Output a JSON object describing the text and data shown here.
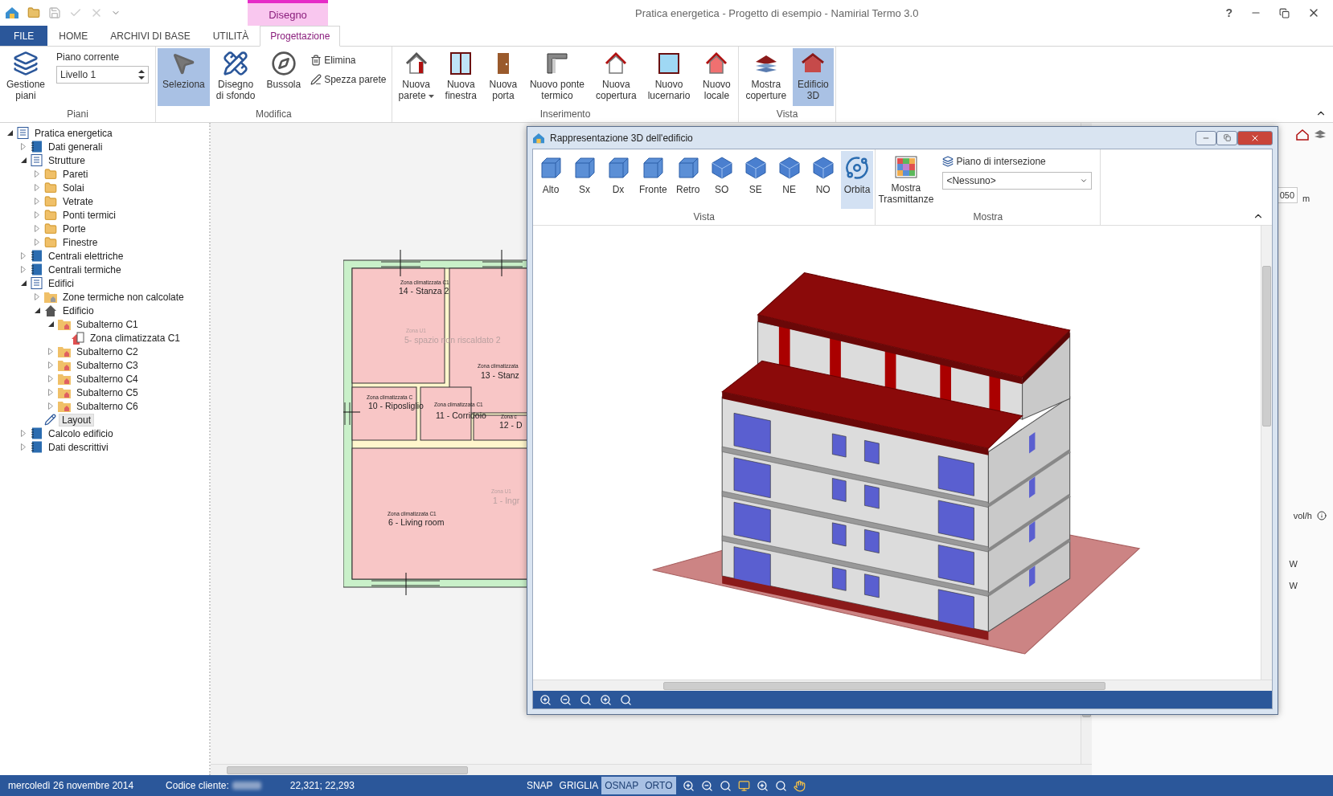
{
  "title_bar": {
    "contextual_tab": "Disegno",
    "title": "Pratica energetica - Progetto di esempio - Namirial Termo 3.0",
    "help": "?"
  },
  "tabs": [
    {
      "label": "FILE",
      "kind": "file",
      "selected": false
    },
    {
      "label": "HOME",
      "kind": "normal",
      "selected": false
    },
    {
      "label": "ARCHIVI DI BASE",
      "kind": "normal",
      "selected": false
    },
    {
      "label": "UTILITÀ",
      "kind": "normal",
      "selected": false
    },
    {
      "label": "Progettazione",
      "kind": "contextual",
      "selected": true
    }
  ],
  "ribbon": {
    "groups": [
      {
        "label": "Piani",
        "items": [
          {
            "kind": "large",
            "label": "Gestione\npiani",
            "selected": false,
            "dropdown": false
          },
          {
            "kind": "spinner",
            "label": "Piano corrente",
            "value": "Livello 1"
          }
        ]
      },
      {
        "label": "Modifica",
        "items": [
          {
            "kind": "large",
            "label": "Seleziona",
            "selected": true,
            "dropdown": false
          },
          {
            "kind": "large",
            "label": "Disegno\ndi sfondo",
            "selected": false,
            "dropdown": false
          },
          {
            "kind": "large",
            "label": "Bussola",
            "selected": false,
            "dropdown": false
          },
          {
            "kind": "stack",
            "items": [
              {
                "label": "Elimina"
              },
              {
                "label": "Spezza parete"
              }
            ]
          }
        ]
      },
      {
        "label": "Inserimento",
        "items": [
          {
            "kind": "large",
            "label": "Nuova\nparete",
            "selected": false,
            "dropdown": true
          },
          {
            "kind": "large",
            "label": "Nuova\nfinestra",
            "selected": false,
            "dropdown": false
          },
          {
            "kind": "large",
            "label": "Nuova\nporta",
            "selected": false,
            "dropdown": false
          },
          {
            "kind": "large",
            "label": "Nuovo ponte\ntermico",
            "selected": false,
            "dropdown": false
          },
          {
            "kind": "large",
            "label": "Nuova\ncopertura",
            "selected": false,
            "dropdown": false
          },
          {
            "kind": "large",
            "label": "Nuovo\nlucernario",
            "selected": false,
            "dropdown": false
          },
          {
            "kind": "large",
            "label": "Nuovo\nlocale",
            "selected": false,
            "dropdown": false
          }
        ]
      },
      {
        "label": "Vista",
        "items": [
          {
            "kind": "large",
            "label": "Mostra\ncoperture",
            "selected": false,
            "dropdown": false
          },
          {
            "kind": "large",
            "label": "Edificio\n3D",
            "selected": true,
            "dropdown": false
          }
        ]
      }
    ]
  },
  "tree": [
    {
      "label": "Pratica energetica",
      "kind": "section",
      "expanded": true,
      "selected": false,
      "children": [
        {
          "label": "Dati generali",
          "kind": "book",
          "expanded": false,
          "selected": false
        },
        {
          "label": "Strutture",
          "kind": "section",
          "expanded": true,
          "selected": false,
          "children": [
            {
              "label": "Pareti",
              "kind": "folder",
              "expanded": false,
              "selected": false
            },
            {
              "label": "Solai",
              "kind": "folder",
              "expanded": false,
              "selected": false
            },
            {
              "label": "Vetrate",
              "kind": "folder",
              "expanded": false,
              "selected": false
            },
            {
              "label": "Ponti termici",
              "kind": "folder",
              "expanded": false,
              "selected": false
            },
            {
              "label": "Porte",
              "kind": "folder",
              "expanded": false,
              "selected": false
            },
            {
              "label": "Finestre",
              "kind": "folder",
              "expanded": false,
              "selected": false
            }
          ]
        },
        {
          "label": "Centrali elettriche",
          "kind": "book",
          "expanded": false,
          "selected": false
        },
        {
          "label": "Centrali termiche",
          "kind": "book",
          "expanded": false,
          "selected": false
        },
        {
          "label": "Edifici",
          "kind": "section",
          "expanded": true,
          "selected": false,
          "children": [
            {
              "label": "Zone termiche non calcolate",
              "kind": "zonefolder",
              "expanded": false,
              "selected": false
            },
            {
              "label": "Edificio",
              "kind": "house",
              "expanded": true,
              "selected": false,
              "children": [
                {
                  "label": "Subalterno C1",
                  "kind": "subfolder",
                  "expanded": true,
                  "selected": false,
                  "children": [
                    {
                      "label": "Zona climatizzata C1",
                      "kind": "zone",
                      "selected": false
                    }
                  ]
                },
                {
                  "label": "Subalterno C2",
                  "kind": "subfolder",
                  "expanded": false,
                  "selected": false
                },
                {
                  "label": "Subalterno C3",
                  "kind": "subfolder",
                  "expanded": false,
                  "selected": false
                },
                {
                  "label": "Subalterno C4",
                  "kind": "subfolder",
                  "expanded": false,
                  "selected": false
                },
                {
                  "label": "Subalterno C5",
                  "kind": "subfolder",
                  "expanded": false,
                  "selected": false
                },
                {
                  "label": "Subalterno C6",
                  "kind": "subfolder",
                  "expanded": false,
                  "selected": false
                }
              ]
            },
            {
              "label": "Layout",
              "kind": "layout",
              "selected": true
            }
          ]
        },
        {
          "label": "Calcolo edificio",
          "kind": "book",
          "expanded": false,
          "selected": false
        },
        {
          "label": "Dati descrittivi",
          "kind": "book",
          "expanded": false,
          "selected": false
        }
      ]
    }
  ],
  "floor_plan": {
    "rooms": [
      {
        "zone": "Zona climatizzata C1",
        "name": "14 - Stanza 2",
        "heated": true
      },
      {
        "zone": "Zona U1",
        "name": "5- spazio non riscaldato 2",
        "heated": false
      },
      {
        "zone": "Zona climatizzata",
        "name": "13 - Stanz",
        "heated": true
      },
      {
        "zone": "Zona climatizzata C",
        "name": "10 - Riposliglio",
        "heated": true
      },
      {
        "zone": "Zona climatizzata C1",
        "name": "11 - Corridoio",
        "heated": true
      },
      {
        "zone": "Zona c",
        "name": "12 - D",
        "heated": true
      },
      {
        "zone": "Zona U1",
        "name": "1 - Ingr",
        "heated": false
      },
      {
        "zone": "Zona climatizzata C1",
        "name": "6 - Living room",
        "heated": true
      }
    ]
  },
  "right_panel": {
    "length_value": "050",
    "length_unit": "m",
    "rate_unit": "vol/h",
    "power_units": [
      "W",
      "W"
    ]
  },
  "dialog": {
    "title": "Rappresentazione 3D dell'edificio",
    "view_group": {
      "label": "Vista",
      "buttons": [
        {
          "label": "Alto",
          "selected": false
        },
        {
          "label": "Sx",
          "selected": false
        },
        {
          "label": "Dx",
          "selected": false
        },
        {
          "label": "Fronte",
          "selected": false
        },
        {
          "label": "Retro",
          "selected": false
        },
        {
          "label": "SO",
          "selected": false
        },
        {
          "label": "SE",
          "selected": false
        },
        {
          "label": "NE",
          "selected": false
        },
        {
          "label": "NO",
          "selected": false
        },
        {
          "label": "Orbita",
          "selected": true
        }
      ]
    },
    "show_group": {
      "label": "Mostra",
      "button": "Mostra\nTrasmittanze",
      "field_label": "Piano di intersezione",
      "value": "<Nessuno>"
    }
  },
  "status_bar": {
    "date": "mercoledì 26 novembre 2014",
    "client_label": "Codice cliente:",
    "coords": "22,321; 22,293",
    "toggles": [
      {
        "label": "SNAP",
        "on": false
      },
      {
        "label": "GRIGLIA",
        "on": false
      },
      {
        "label": "OSNAP",
        "on": true
      },
      {
        "label": "ORTO",
        "on": true
      }
    ]
  }
}
